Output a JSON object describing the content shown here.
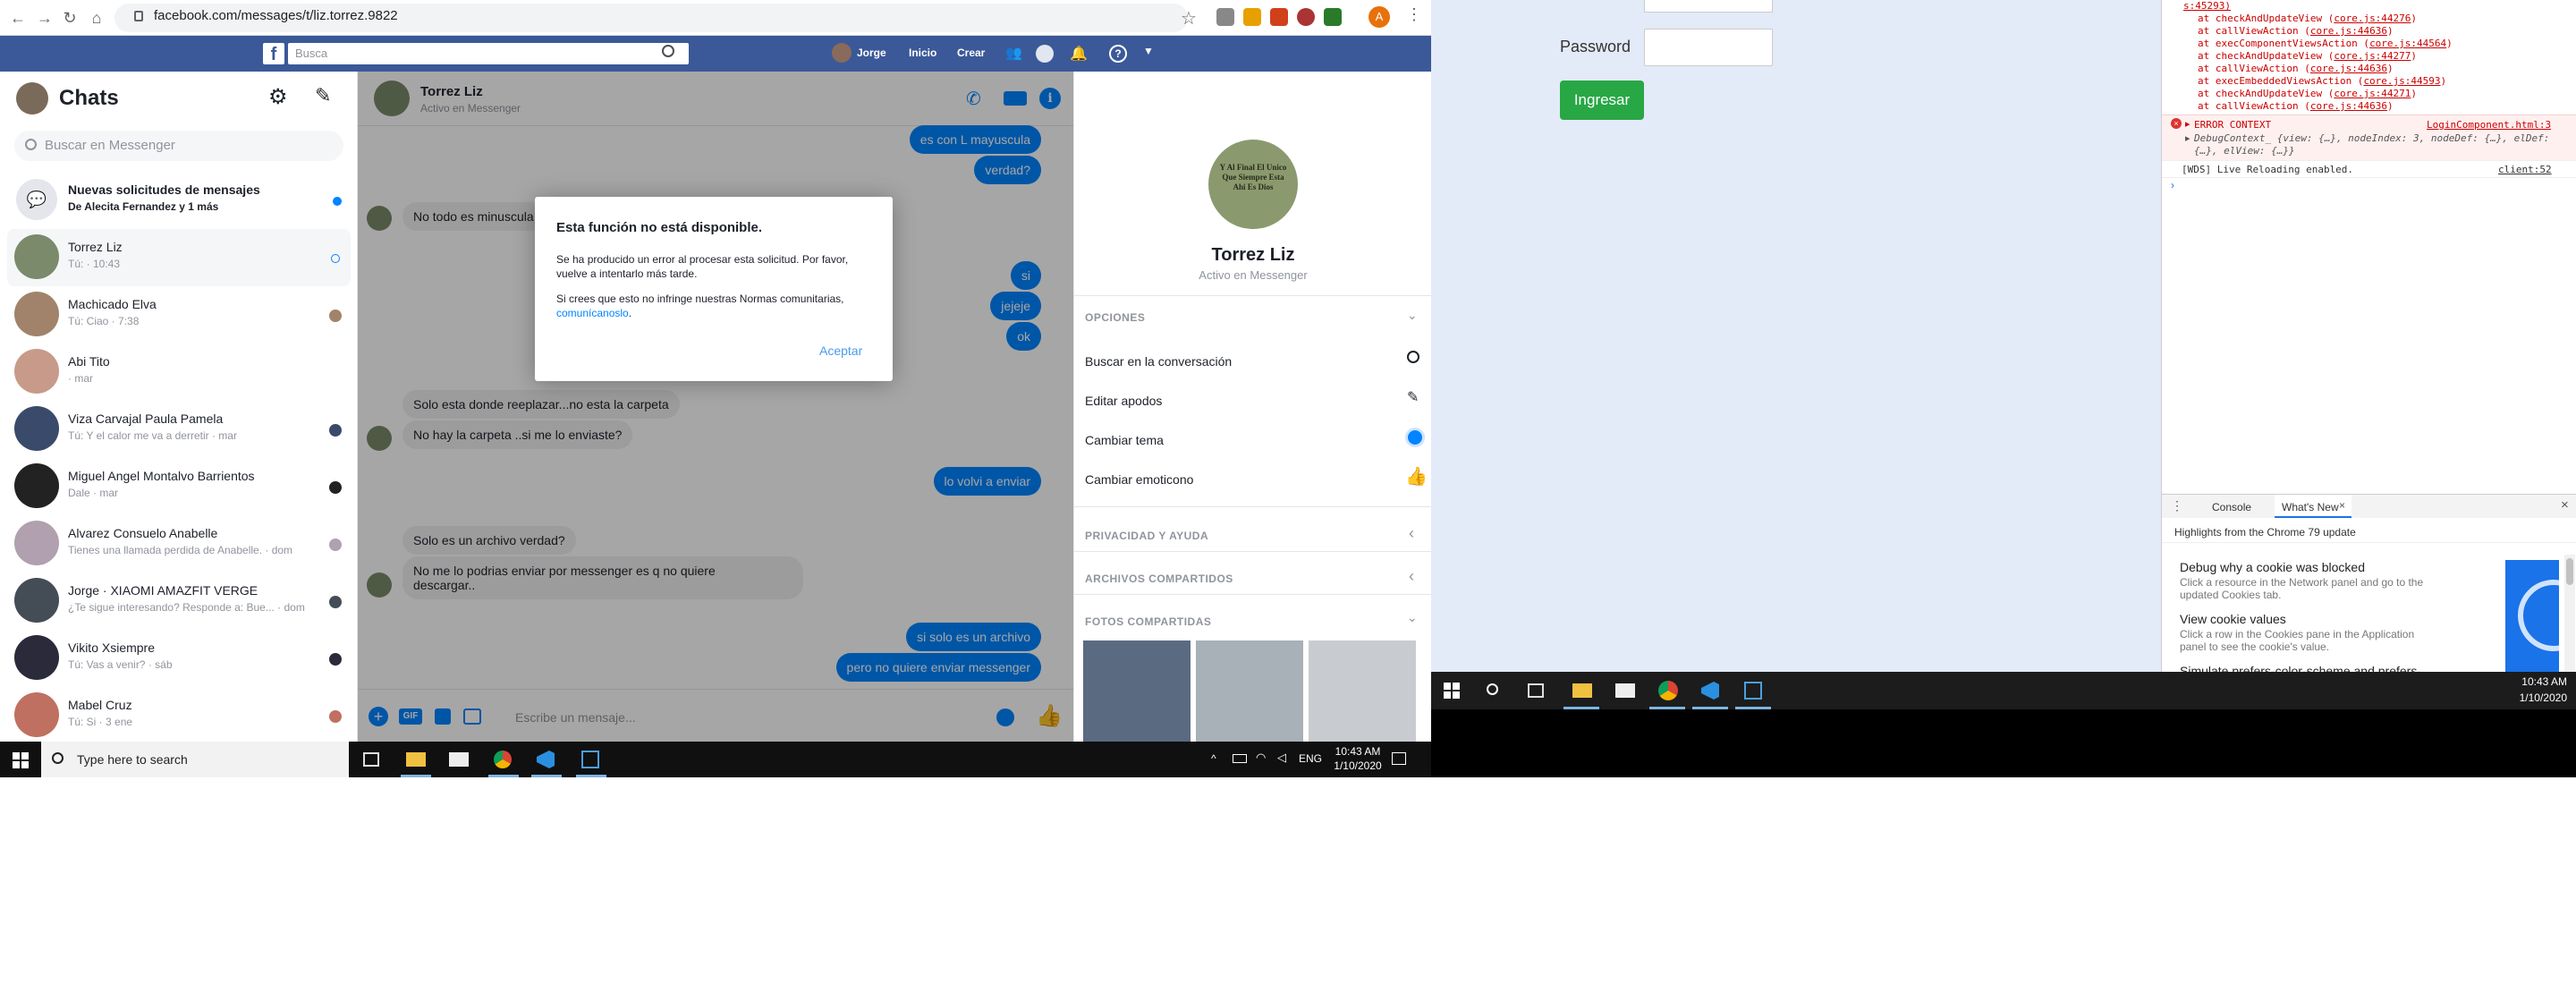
{
  "browser": {
    "url": "facebook.com/messages/t/liz.torrez.9822",
    "profile_initial": "A"
  },
  "fb_nav": {
    "search_placeholder": "Busca",
    "user": "Jorge",
    "home": "Inicio",
    "create": "Crear"
  },
  "chats": {
    "title": "Chats",
    "search_placeholder": "Buscar en Messenger",
    "requests_title": "Nuevas solicitudes de mensajes",
    "requests_sub": "De Alecita Fernandez y 1 más",
    "items": [
      {
        "name": "Torrez Liz",
        "preview": "Tú: · 10:43",
        "color": "#7a8a6a"
      },
      {
        "name": "Machicado Elva",
        "preview": "Tú: Ciao · 7:38",
        "color": "#a0836a"
      },
      {
        "name": "Abi Tito",
        "preview": "· mar",
        "color": "#c89a8a"
      },
      {
        "name": "Viza Carvajal Paula Pamela",
        "preview": "Tú: Y el calor me va a derretir · mar",
        "color": "#3a4a6a"
      },
      {
        "name": "Miguel Angel Montalvo Barrientos",
        "preview": "Dale · mar",
        "color": "#222222"
      },
      {
        "name": "Alvarez Consuelo Anabelle",
        "preview": "Tienes una llamada perdida de Anabelle. · dom",
        "color": "#b0a0b0"
      },
      {
        "name": "Jorge · XIAOMI AMAZFIT VERGE",
        "preview": "¿Te sigue interesando? Responde a: Bue... · dom",
        "color": "#444c55"
      },
      {
        "name": "Vikito Xsiempre",
        "preview": "Tú: Vas a venir? · sáb",
        "color": "#2a2a3a"
      },
      {
        "name": "Mabel Cruz",
        "preview": "Tú: Si · 3 ene",
        "color": "#c07060"
      }
    ]
  },
  "conversation": {
    "name": "Torrez Liz",
    "status": "Activo en Messenger",
    "messages": [
      {
        "dir": "out",
        "text": "es con L mayuscula"
      },
      {
        "dir": "out",
        "text": "verdad?"
      },
      {
        "dir": "in",
        "text": "No todo es minuscula"
      },
      {
        "dir": "out",
        "text": "si"
      },
      {
        "dir": "out",
        "text": "jejeje"
      },
      {
        "dir": "out",
        "text": "ok"
      },
      {
        "dir": "in",
        "text": "Solo esta donde reeplazar...no esta la carpeta"
      },
      {
        "dir": "in",
        "text": "No hay la carpeta ..si me lo enviaste?"
      },
      {
        "dir": "out",
        "text": "lo volvi a enviar"
      },
      {
        "dir": "in",
        "text": "Solo es un archivo verdad?"
      },
      {
        "dir": "in",
        "text": "No me lo podrias enviar por messenger es q no quiere"
      },
      {
        "dir": "in",
        "text": "descargar.."
      },
      {
        "dir": "out",
        "text": "si solo es un archivo"
      },
      {
        "dir": "out",
        "text": "pero no quiere enviar messenger"
      }
    ],
    "composer_placeholder": "Escribe un mensaje..."
  },
  "info_panel": {
    "profile_text": "Y Al Final El Unico Que Siempre Esta Ahi Es Dios",
    "name": "Torrez Liz",
    "status": "Activo en Messenger",
    "options_title": "OPCIONES",
    "options": [
      "Buscar en la conversación",
      "Editar apodos",
      "Cambiar tema",
      "Cambiar emoticono"
    ],
    "privacy_title": "PRIVACIDAD Y AYUDA",
    "files_title": "ARCHIVOS COMPARTIDOS",
    "photos_title": "FOTOS COMPARTIDAS"
  },
  "dialog": {
    "title": "Esta función no está disponible.",
    "body1": "Se ha producido un error al procesar esta solicitud. Por favor, vuelve a intentarlo más tarde.",
    "body2": "Si crees que esto no infringe nuestras Normas comunitarias,",
    "link": "comunícanoslo",
    "accept": "Aceptar"
  },
  "taskbar_left": {
    "search": "Type here to search",
    "lang": "ENG",
    "time": "10:43 AM",
    "date": "1/10/2020"
  },
  "login": {
    "password_label": "Password",
    "submit": "Ingresar"
  },
  "devtools": {
    "top_link": "s:45293)",
    "stack1": [
      {
        "fn": "at checkAndUpdateView",
        "src": "core.js:44276"
      },
      {
        "fn": "at callViewAction",
        "src": "core.js:44636"
      },
      {
        "fn": "at execComponentViewsAction",
        "src": "core.js:44564"
      },
      {
        "fn": "at checkAndUpdateView",
        "src": "core.js:44277"
      },
      {
        "fn": "at callViewAction",
        "src": "core.js:44636"
      },
      {
        "fn": "at execEmbeddedViewsAction",
        "src": "core.js:44593"
      },
      {
        "fn": "at checkAndUpdateView",
        "src": "core.js:44271"
      },
      {
        "fn": "at callViewAction",
        "src": "core.js:44636"
      }
    ],
    "error_context": "ERROR CONTEXT",
    "error_src": "LoginComponent.html:3",
    "debug_line1": "DebugContext_ {view: {…}, nodeIndex: 3, nodeDef: {…}, elDef:",
    "debug_line2": "{…}, elView: {…}}",
    "wds": "[WDS] Live Reloading enabled.",
    "wds_src": "client:52",
    "tabs": [
      "Console",
      "What's New"
    ],
    "whatsnew_header": "Highlights from the Chrome 79 update",
    "items": [
      {
        "title": "Debug why a cookie was blocked",
        "desc1": "Click a resource in the Network panel and go to the",
        "desc2": "updated Cookies tab."
      },
      {
        "title": "View cookie values",
        "desc1": "Click a row in the Cookies pane in the Application",
        "desc2": "panel to see the cookie's value."
      },
      {
        "title": "Simulate prefers-color-scheme and prefers-",
        "desc1": "",
        "desc2": ""
      }
    ]
  },
  "taskbar_right": {
    "time": "10:43 AM",
    "date": "1/10/2020"
  }
}
